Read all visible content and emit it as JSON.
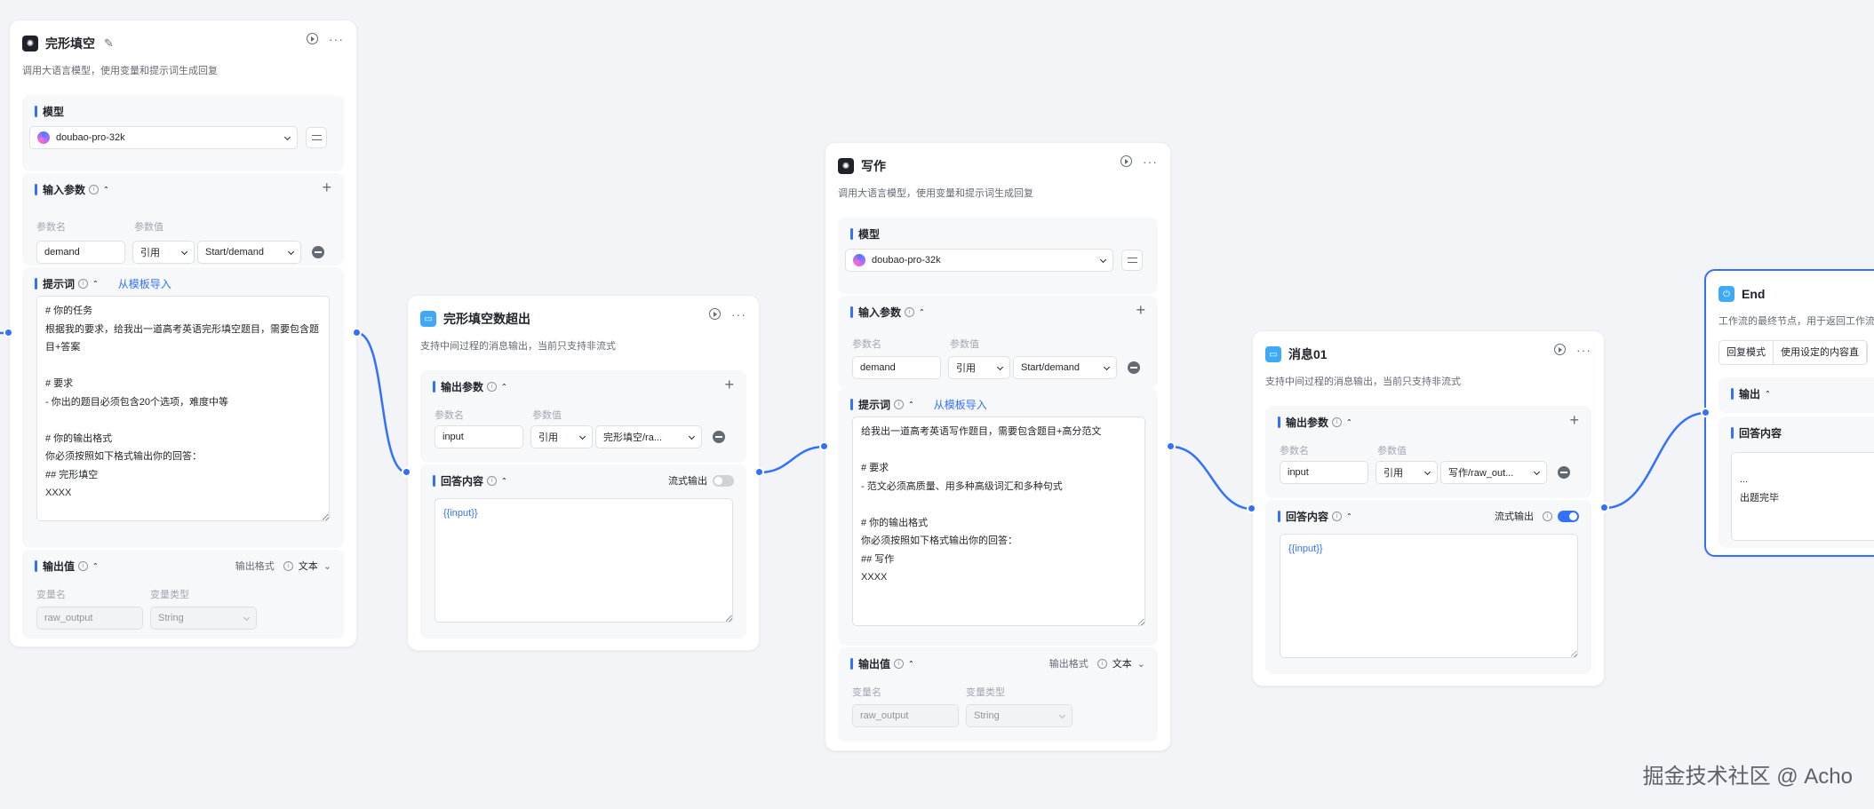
{
  "node1": {
    "title": "完形填空",
    "desc": "调用大语言模型，使用变量和提示词生成回复",
    "model": {
      "title": "模型",
      "value": "doubao-pro-32k"
    },
    "input": {
      "title": "输入参数",
      "name_label": "参数名",
      "value_label": "参数值",
      "name": "demand",
      "type": "引用",
      "value": "Start/demand"
    },
    "prompt": {
      "title": "提示词",
      "template": "从模板导入",
      "text": "# 你的任务\n根据我的要求，给我出一道高考英语完形填空题目，需要包含题目+答案\n\n# 要求\n- 你出的题目必须包含20个选项，难度中等\n\n# 你的输出格式\n你必须按照如下格式输出你的回答：\n## 完形填空\nXXXX"
    },
    "output": {
      "title": "输出值",
      "format_label": "输出格式",
      "format_value": "文本",
      "name_label": "变量名",
      "type_label": "变量类型",
      "name": "raw_output",
      "type": "String"
    }
  },
  "node2": {
    "title": "完形填空数超出",
    "desc": "支持中间过程的消息输出，当前只支持非流式",
    "output": {
      "title": "输出参数",
      "name_label": "参数名",
      "value_label": "参数值",
      "name": "input",
      "type": "引用",
      "value": "完形填空/ra..."
    },
    "answer": {
      "title": "回答内容",
      "stream_label": "流式输出",
      "stream_on": false,
      "text": "{{input}}"
    }
  },
  "node3": {
    "title": "写作",
    "desc": "调用大语言模型，使用变量和提示词生成回复",
    "model": {
      "title": "模型",
      "value": "doubao-pro-32k"
    },
    "input": {
      "title": "输入参数",
      "name_label": "参数名",
      "value_label": "参数值",
      "name": "demand",
      "type": "引用",
      "value": "Start/demand"
    },
    "prompt": {
      "title": "提示词",
      "template": "从模板导入",
      "text": "给我出一道高考英语写作题目，需要包含题目+高分范文\n\n# 要求\n- 范文必须高质量、用多种高级词汇和多种句式\n\n# 你的输出格式\n你必须按照如下格式输出你的回答：\n## 写作\nXXXX"
    },
    "output": {
      "title": "输出值",
      "format_label": "输出格式",
      "format_value": "文本",
      "name_label": "变量名",
      "type_label": "变量类型",
      "name": "raw_output",
      "type": "String"
    }
  },
  "node4": {
    "title": "消息01",
    "desc": "支持中间过程的消息输出，当前只支持非流式",
    "output": {
      "title": "输出参数",
      "name_label": "参数名",
      "value_label": "参数值",
      "name": "input",
      "type": "引用",
      "value": "写作/raw_out..."
    },
    "answer": {
      "title": "回答内容",
      "stream_label": "流式输出",
      "stream_on": true,
      "text": "{{input}}"
    }
  },
  "node5": {
    "title": "End",
    "desc": "工作流的最终节点，用于返回工作流",
    "mode_label": "回复模式",
    "mode_value": "使用设定的内容直",
    "output": {
      "title": "输出"
    },
    "answer": {
      "title": "回答内容",
      "text": "...\n出题完毕"
    }
  },
  "watermark": "掘金技术社区 @ Acho",
  "colors": {
    "accent": "#3370ff",
    "background": "#f3f4f8"
  }
}
